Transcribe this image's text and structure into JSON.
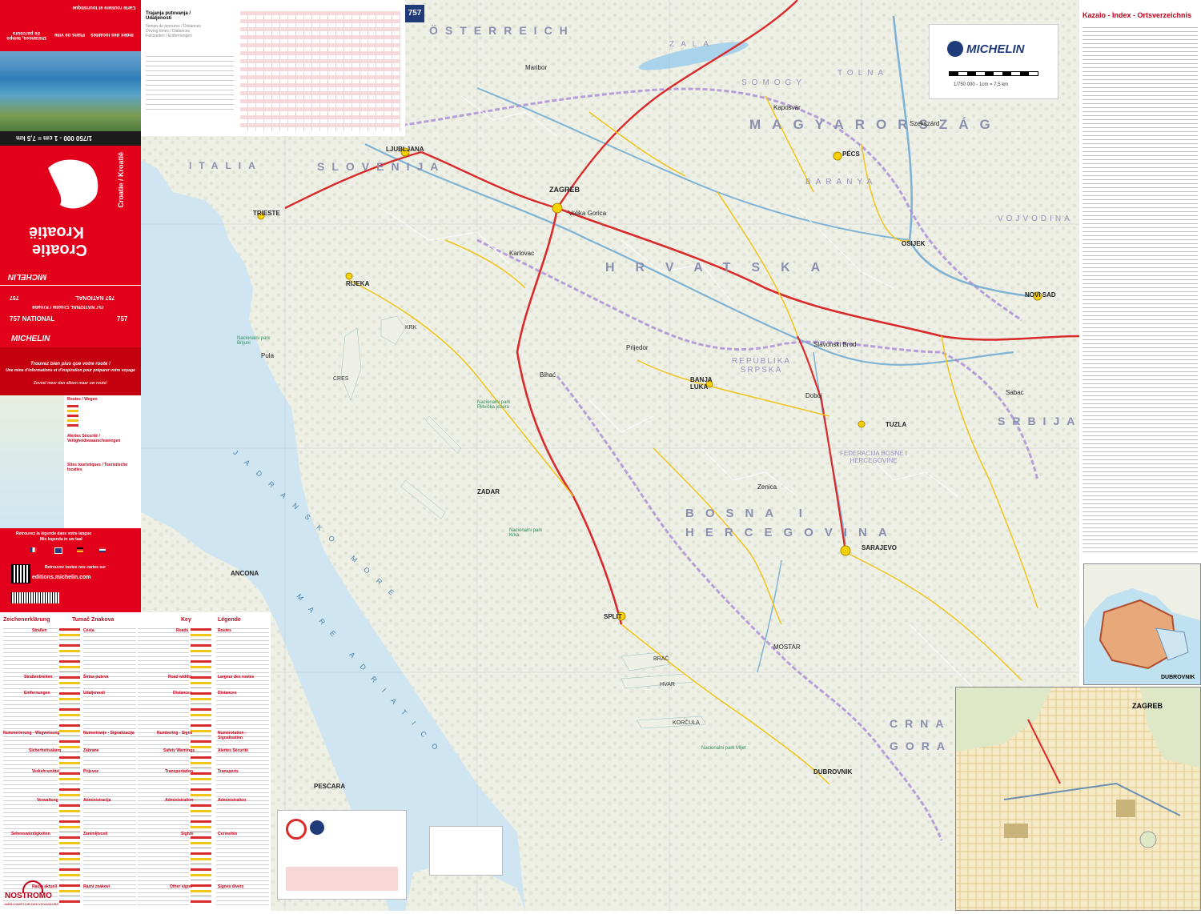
{
  "cover": {
    "title_fr": "Croatie",
    "title_nl": "Kroatië",
    "subtitle": "Croatie / Kroatië",
    "scale": "1/750 000 - 1 cm = 7,5 km",
    "brand": "MICHELIN",
    "series": "757 NATIONAL",
    "series_line": "757 NATIONAL Croatie / Kroatië",
    "number": "757",
    "top_lines": [
      "Index des localités",
      "Plans de ville",
      "Distances, temps de parcours",
      "Carte routière et touristique"
    ],
    "promo_1": "Trouvez bien plus que votre route !",
    "promo_2": "Une mine d'informations et d'inspiration pour préparer votre voyage",
    "promo_3": "Zoveel meer dan alleen maar uw route!",
    "legend_title_1": "Routes / Wegen",
    "legend_title_2": "Alertes Sécurité / Veiligheidswaarschuwingen",
    "legend_title_3": "Sites touristiques / Toeristische locaties",
    "lang_title": "Retrouvez la légende dans votre langue",
    "lang_sub": "Mix legenda in uw taal",
    "website": "editions.michelin.com",
    "website_note": "Retrouvez toutes nos cartes sur"
  },
  "distance_table": {
    "title": "Trajanja putovanja / Udaljenosti",
    "subtitle": "Tempo de percurso / Distances",
    "subtitle2": "Driving times / Distances",
    "subtitle3": "Fahrzeiten / Entfernungen"
  },
  "map": {
    "edition_badge": "757",
    "brand": "MICHELIN",
    "scale_text": "1/750 000 - 1cm = 7,5 km",
    "countries": [
      "ÖSTERREICH",
      "SLOVENIJA",
      "MAGYARORSZÁG",
      "HRVATSKA",
      "BOSNA I HERCEGOVINA",
      "SRBIJA",
      "CRNA GORA",
      "ITALIA"
    ],
    "regions": [
      "ZALA",
      "SOMOGY",
      "TOLNA",
      "BARANYA",
      "VOJVODINA",
      "REPUBLIKA SRPSKA",
      "FEDERACIJA BOSNE I HERCEGOVINE"
    ],
    "sea": "JADRANSKO MORE",
    "sea2": "MARE ADRIATICO",
    "cities": [
      "LJUBLJANA",
      "ZAGREB",
      "TRIESTE",
      "RIJEKA",
      "PÉCS",
      "OSIJEK",
      "NOVI SAD",
      "BANJA LUKA",
      "TUZLA",
      "SARAJEVO",
      "SPLIT",
      "ZADAR",
      "DUBROVNIK",
      "ANCONA",
      "PESCARA",
      "MOSTAR",
      "Karlovac",
      "Pula",
      "Slavonski Brod",
      "Prijedor",
      "Zenica",
      "Sabac",
      "Szekszárd",
      "Kaposvár",
      "Maribor",
      "Velika Gorica",
      "Doboj",
      "Bihać"
    ],
    "islands": [
      "KRK",
      "CRES",
      "BRAČ",
      "HVAR",
      "KORČULA"
    ],
    "parks": [
      "Nacionalni park Plitvička jezera",
      "Nacionalni park Brijuni",
      "Nacionalni park Krka",
      "Nacionalni park Mljet"
    ]
  },
  "index": {
    "title": "Kazalo - Index - Ortsverzeichnis"
  },
  "legend": {
    "col1": "Zeichenerklärung",
    "col2": "Tumač Znakova",
    "col3": "Key",
    "col4": "Légende",
    "sections": [
      "Straßen",
      "Cesta",
      "Roads",
      "Routes",
      "Straßenbreiten",
      "Širina puteva",
      "Road widths",
      "Largeur des routes",
      "Entfernungen",
      "Udaljenosti",
      "Distances",
      "Distances",
      "Nummerierung - Wegweisung",
      "Numeriranje - Signalizacija",
      "Numbering - Signs",
      "Numérotation - Signalisation",
      "Sicherheitsalarm",
      "Zabrane",
      "Safety Warnings",
      "Alertes Sécurité",
      "Verkehrsmittel",
      "Prijevoz",
      "Transportation",
      "Transports",
      "Verwaltung",
      "Administracija",
      "Administration",
      "Administration",
      "Sehenswürdigkeiten",
      "Zanimljivosti",
      "Sights",
      "Curiosités",
      "Raum aktuell",
      "Razni znakovi",
      "Other signs",
      "Signes divers"
    ]
  },
  "insets": {
    "dubrovnik": "DUBROVNIK",
    "zagreb": "ZAGREB"
  },
  "watermark": {
    "name": "NOSTROMO",
    "tagline": "WEB COMPTOIR DES VOYAGEURS"
  },
  "colors": {
    "cover_red": "#e2001a",
    "sea": "#cfe6f2",
    "land": "#f4f1e6",
    "highway": "#d92b2b",
    "road": "#f0c419",
    "border": "#6a5acd"
  }
}
